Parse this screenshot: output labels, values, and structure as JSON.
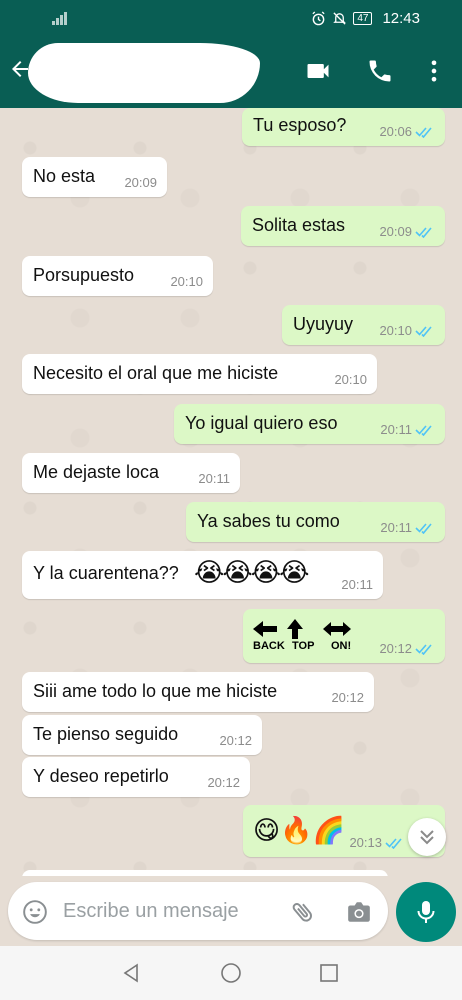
{
  "status_bar": {
    "battery": "47",
    "time": "12:43"
  },
  "header": {
    "back_icon": "back-arrow-icon",
    "video_icon": "video-call-icon",
    "call_icon": "phone-icon",
    "menu_icon": "more-vert-icon"
  },
  "messages": [
    {
      "dir": "out",
      "text": "Tu esposo?",
      "time": "20:06",
      "ticks": true
    },
    {
      "dir": "in",
      "text": "No esta",
      "time": "20:09"
    },
    {
      "dir": "out",
      "text": "Solita estas",
      "time": "20:09",
      "ticks": true
    },
    {
      "dir": "in",
      "text": "Porsupuesto",
      "time": "20:10"
    },
    {
      "dir": "out",
      "text": "Uyuyuy",
      "time": "20:10",
      "ticks": true
    },
    {
      "dir": "in",
      "text": "Necesito el oral que me hiciste",
      "time": "20:10"
    },
    {
      "dir": "out",
      "text": "Yo igual quiero eso",
      "time": "20:11",
      "ticks": true
    },
    {
      "dir": "in",
      "text": "Me dejaste loca",
      "time": "20:11"
    },
    {
      "dir": "out",
      "text": "Ya sabes tu como",
      "time": "20:11",
      "ticks": true
    },
    {
      "dir": "in",
      "text": "Y la cuarentena??",
      "emoji": "😭😭😭😭",
      "time": "20:11"
    },
    {
      "dir": "out",
      "emoji_labels": [
        "BACK",
        "TOP",
        "ON!"
      ],
      "time": "20:12",
      "ticks": true
    },
    {
      "dir": "in",
      "text": "Siii ame todo lo que me hiciste",
      "time": "20:12"
    },
    {
      "dir": "in",
      "text": "Te pienso seguido",
      "time": "20:12"
    },
    {
      "dir": "in",
      "text": "Y deseo repetirlo",
      "time": "20:12"
    },
    {
      "dir": "out",
      "emoji": "😋🔥🌈",
      "time": "20:13",
      "ticks": true
    }
  ],
  "input": {
    "placeholder": "Escribe un mensaje"
  },
  "colors": {
    "header": "#095e54",
    "outgoing": "#dcf8c6",
    "incoming": "#ffffff",
    "tick": "#4fc3f7",
    "mic": "#00897b"
  }
}
